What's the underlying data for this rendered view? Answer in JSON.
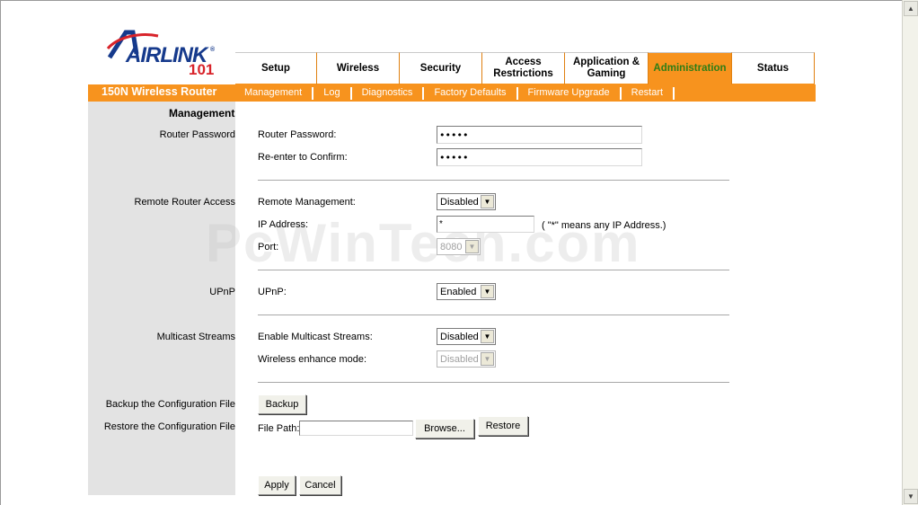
{
  "brand": {
    "logo_text": "AIRLINK",
    "logo_number": "101",
    "registered": "®",
    "product_name": "150N Wireless Router"
  },
  "tabs": [
    {
      "label": "Setup",
      "active": false
    },
    {
      "label": "Wireless",
      "active": false
    },
    {
      "label": "Security",
      "active": false
    },
    {
      "label": "Access\nRestrictions",
      "active": false
    },
    {
      "label": "Application &\nGaming",
      "active": false
    },
    {
      "label": "Administration",
      "active": true
    },
    {
      "label": "Status",
      "active": false
    }
  ],
  "subnav": [
    "Management",
    "Log",
    "Diagnostics",
    "Factory Defaults",
    "Firmware Upgrade",
    "Restart"
  ],
  "page": {
    "title": "Management",
    "sections": {
      "router_password": "Router Password",
      "remote_access": "Remote Router Access",
      "upnp": "UPnP",
      "multicast": "Multicast Streams",
      "backup": "Backup the Configuration File",
      "restore": "Restore the Configuration File"
    }
  },
  "fields": {
    "router_password_label": "Router Password:",
    "router_password_value": "admin",
    "reenter_label": "Re-enter to Confirm:",
    "reenter_value": "admin",
    "remote_mgmt_label": "Remote Management:",
    "remote_mgmt_value": "Disabled",
    "ip_label": "IP Address:",
    "ip_value": "*",
    "ip_note": "( \"*\" means any IP Address.)",
    "port_label": "Port:",
    "port_value": "8080",
    "upnp_label": "UPnP:",
    "upnp_value": "Enabled",
    "multicast_label": "Enable Multicast Streams:",
    "multicast_value": "Disabled",
    "wireless_enhance_label": "Wireless enhance mode:",
    "wireless_enhance_value": "Disabled",
    "file_path_label": "File Path:",
    "file_path_value": ""
  },
  "buttons": {
    "backup": "Backup",
    "browse": "Browse...",
    "restore": "Restore",
    "apply": "Apply",
    "cancel": "Cancel"
  },
  "watermark": "PcWinTech.com",
  "colors": {
    "orange": "#f7931e",
    "active_tab_text": "#2e7d16",
    "left_column": "#e3e3e3",
    "logo_blue": "#163a8c",
    "logo_red": "#d8232a"
  }
}
